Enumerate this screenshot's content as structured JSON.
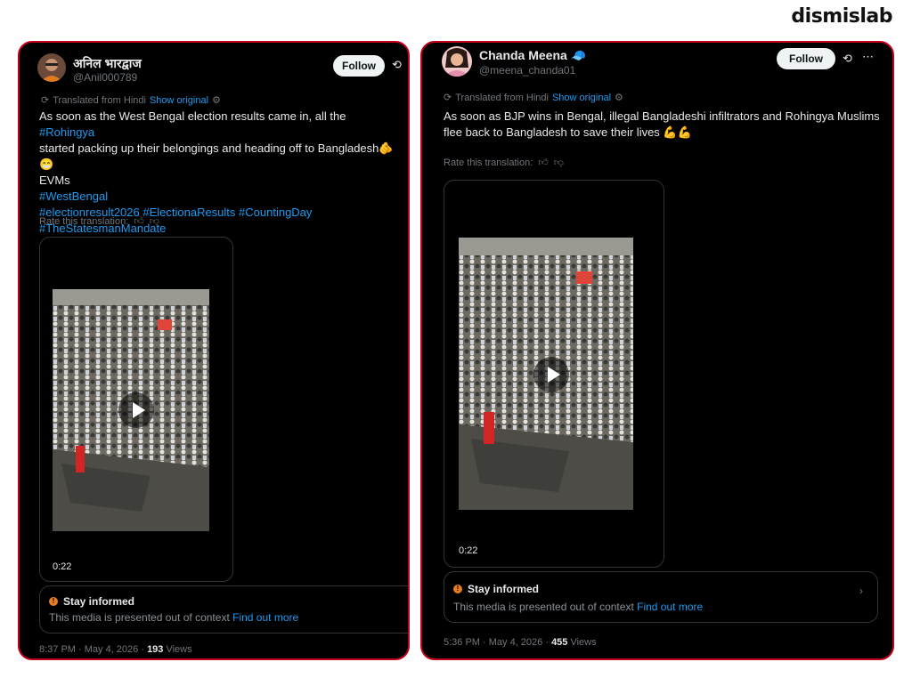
{
  "brand": "dismislab",
  "post1": {
    "name": "अनिल भारद्वाज",
    "handle": "@Anil000789",
    "follow_label": "Follow",
    "translated_from": "Translated from Hindi",
    "show_original": "Show original",
    "text_plain1": "As soon as the West Bengal election results came in, all the ",
    "tag_rohingya": "#Rohingya",
    "text_plain2": "started packing up their belongings and heading off to Bangladesh🫵😁",
    "text_plain3": "EVMs",
    "tag_westbengal": "#WestBengal",
    "tag_line": "#electionresult2026 #ElectionaResults #CountingDay",
    "tag_mandate": "#TheStatesmanMandate",
    "rate_label": "Rate this translation:",
    "duration": "0:22",
    "notice_title": "Stay informed",
    "notice_body": "This media is presented out of context",
    "notice_link": "Find out more",
    "time": "8:37 PM · May 4, 2026 · ",
    "views_count": "193",
    "views_label": " Views"
  },
  "post2": {
    "name": "Chanda Meena 🧢",
    "handle": "@meena_chanda01",
    "follow_label": "Follow",
    "translated_from": "Translated from Hindi",
    "show_original": "Show original",
    "text": "As soon as BJP wins in Bengal, illegal Bangladeshi infiltrators and Rohingya Muslims flee back to Bangladesh to save their lives 💪💪",
    "rate_label": "Rate this translation:",
    "duration": "0:22",
    "notice_title": "Stay informed",
    "notice_body": "This media is presented out of context",
    "notice_link": "Find out more",
    "time": "5:36 PM · May 4, 2026 · ",
    "views_count": "455",
    "views_label": " Views"
  }
}
